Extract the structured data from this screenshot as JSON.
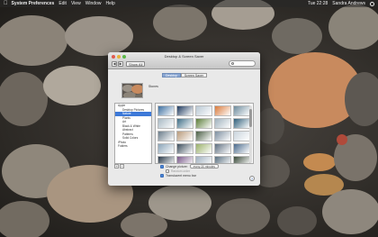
{
  "menubar": {
    "app_name": "System Preferences",
    "items": [
      "Edit",
      "View",
      "Window",
      "Help"
    ],
    "clock": "Tue 22:28",
    "user": "Sandra Andrews"
  },
  "window": {
    "title": "Desktop & Screen Saver",
    "show_all": "Show All",
    "tabs": [
      {
        "label": "Desktop",
        "active": true
      },
      {
        "label": "Screen Saver",
        "active": false
      }
    ],
    "current_picture": "Stones",
    "sources": [
      {
        "label": "Apple",
        "indent": false,
        "selected": false
      },
      {
        "label": "Desktop Pictures",
        "indent": true,
        "selected": false
      },
      {
        "label": "Nature",
        "indent": true,
        "selected": true
      },
      {
        "label": "Plants",
        "indent": true,
        "selected": false
      },
      {
        "label": "Art",
        "indent": true,
        "selected": false
      },
      {
        "label": "Black & White",
        "indent": true,
        "selected": false
      },
      {
        "label": "Abstract",
        "indent": true,
        "selected": false
      },
      {
        "label": "Patterns",
        "indent": true,
        "selected": false
      },
      {
        "label": "Solid Colors",
        "indent": true,
        "selected": false
      },
      {
        "label": "iPhoto",
        "indent": false,
        "selected": false
      },
      {
        "label": "Folders",
        "indent": false,
        "selected": false
      }
    ],
    "list_add": "+",
    "list_remove": "−",
    "change_picture_label": "Change picture:",
    "change_picture_value": "every 30 minutes",
    "random_order_label": "Random order",
    "translucent_label": "Translucent menu bar",
    "help": "?"
  },
  "thumbnails": [
    "#3d6fa0",
    "#1f3a5e",
    "#b8c7d3",
    "#d97a3c",
    "#6c8a9c",
    "#a8b9c4",
    "#3f6e86",
    "#5c7d3a",
    "#9fb1bd",
    "#2f5f7a",
    "#6a7c8a",
    "#b89a7a",
    "#4b5f45",
    "#7d8fa0",
    "#c9d4dc",
    "#8aa4b8",
    "#3c4d5c",
    "#9ab06a",
    "#5e6f80",
    "#4a6a8c",
    "#2a3a4a",
    "#7a5a8a",
    "#a0b0c0",
    "#5a7080",
    "#3a4a3a"
  ]
}
